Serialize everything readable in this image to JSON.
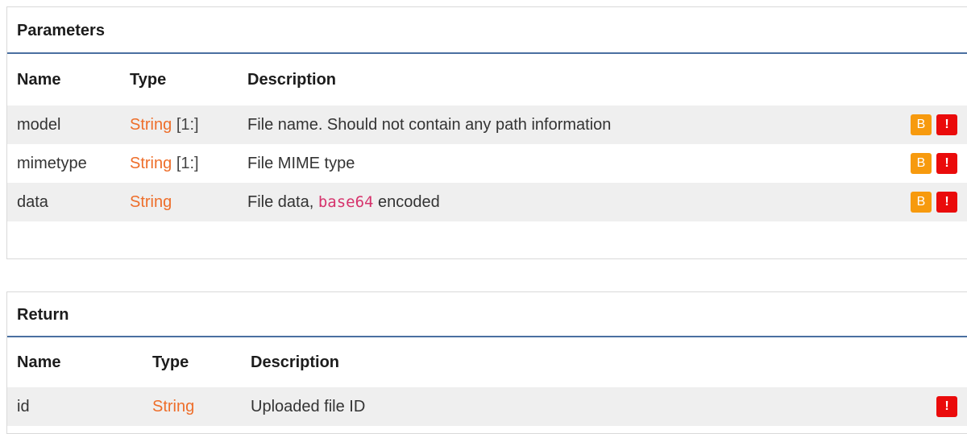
{
  "parameters": {
    "title": "Parameters",
    "headers": {
      "name": "Name",
      "type": "Type",
      "description": "Description"
    },
    "rows": [
      {
        "name": "model",
        "type": "String",
        "cardinality": "[1:]",
        "description": "File name. Should not contain any path information",
        "badges": [
          "B",
          "!"
        ]
      },
      {
        "name": "mimetype",
        "type": "String",
        "cardinality": "[1:]",
        "description": "File MIME type",
        "badges": [
          "B",
          "!"
        ]
      },
      {
        "name": "data",
        "type": "String",
        "cardinality": "",
        "description_prefix": "File data, ",
        "description_code": "base64",
        "description_suffix": " encoded",
        "badges": [
          "B",
          "!"
        ]
      }
    ]
  },
  "return": {
    "title": "Return",
    "headers": {
      "name": "Name",
      "type": "Type",
      "description": "Description"
    },
    "rows": [
      {
        "name": "id",
        "type": "String",
        "description": "Uploaded file ID",
        "badges": [
          "!"
        ]
      }
    ]
  },
  "colors": {
    "type_link": "#ee6e2a",
    "badge_b": "#f79a0e",
    "badge_required": "#ea0b0b",
    "code": "#d6336c",
    "title_rule": "#4a6fa0"
  }
}
